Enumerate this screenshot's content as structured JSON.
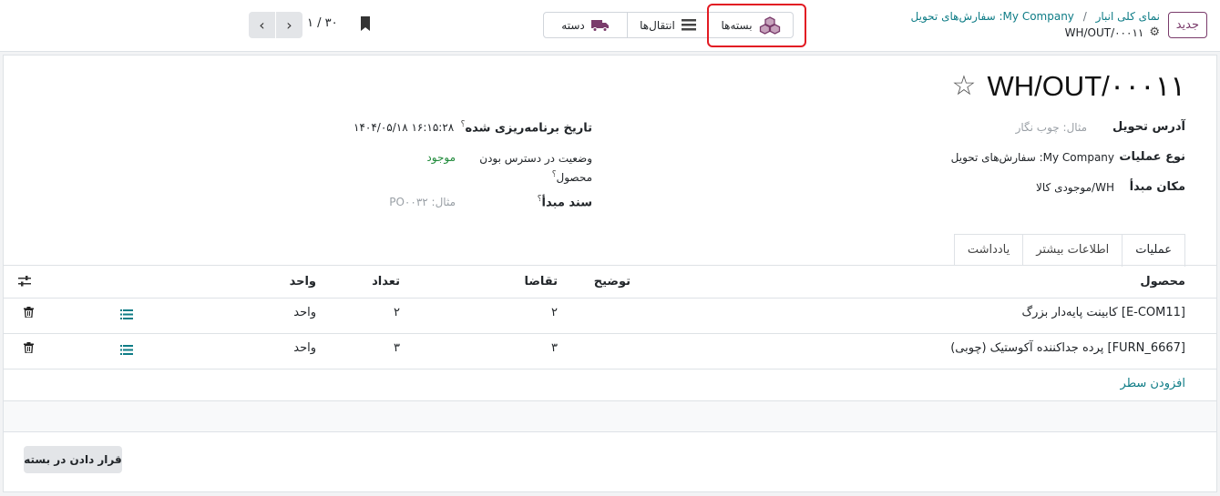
{
  "topbar": {
    "new_button": "جدید",
    "breadcrumb": {
      "parent1": "نمای کلی انبار",
      "separator": "/",
      "parent2": "My Company: سفارش‌های تحویل",
      "current": "WH/OUT/۰۰۰۱۱"
    },
    "smart_buttons": {
      "packages": "بسته‌ها",
      "transfers": "انتقال‌ها",
      "batch": "دسته"
    },
    "pager": {
      "text": "۱ / ۳۰"
    }
  },
  "record": {
    "title": "WH/OUT/۰۰۰۱۱",
    "fields_right": {
      "delivery_address_label": "آدرس تحویل",
      "delivery_address_placeholder": "مثال: چوب نگار",
      "operation_type_label": "نوع عملیات",
      "operation_type_value": "My Company: سفارش‌های تحویل",
      "source_location_label": "مکان مبدأ",
      "source_location_value": "WH/موجودی کالا"
    },
    "fields_left": {
      "scheduled_date_label": "تاریخ برنامه‌ریزی شده",
      "scheduled_date_value": "۱۴۰۴/۰۵/۱۸ ۱۶:۱۵:۲۸",
      "availability_label_line1": "وضعیت در دسترس بودن",
      "availability_label_line2": "محصول",
      "availability_value": "موجود",
      "source_doc_label": "سند مبدأ",
      "source_doc_placeholder": "مثال: PO۰۰۳۲",
      "help_mark": "؟"
    }
  },
  "tabs": [
    "عملیات",
    "اطلاعات بیشتر",
    "یادداشت"
  ],
  "table": {
    "headers": {
      "product": "محصول",
      "description": "توضیح",
      "demand": "تقاضا",
      "quantity": "تعداد",
      "unit": "واحد"
    },
    "rows": [
      {
        "product": "[E-COM11] کابینت پایه‌دار بزرگ",
        "demand": "۲",
        "quantity": "۲",
        "unit": "واحد"
      },
      {
        "product": "[FURN_6667] پرده جداکننده آکوستیک (چوبی)",
        "demand": "۳",
        "quantity": "۳",
        "unit": "واحد"
      }
    ],
    "add_line": "افزودن سطر"
  },
  "footer": {
    "put_in_pack": "قرار دادن در بسته"
  },
  "colors": {
    "brand": "#7a3b6b",
    "link": "#0e7c86",
    "highlight": "#e21b23",
    "available": "#1f8a3a"
  }
}
